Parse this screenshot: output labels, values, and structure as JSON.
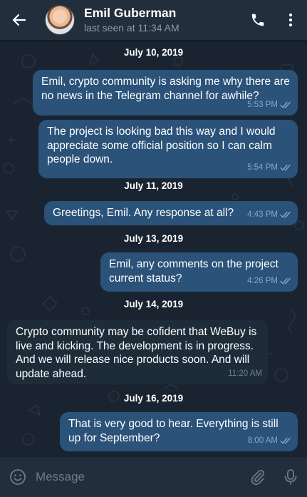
{
  "header": {
    "contact_name": "Emil Guberman",
    "last_seen": "last seen at 11:34 AM"
  },
  "chat": {
    "dates": [
      "July 10, 2019",
      "July 11, 2019",
      "July 13, 2019",
      "July 14, 2019",
      "July 16, 2019"
    ],
    "messages": [
      {
        "direction": "outgoing",
        "text": "Emil, crypto community is asking me why there are no news in the Telegram channel for awhile?",
        "time": "5:53 PM",
        "read": true
      },
      {
        "direction": "outgoing",
        "text": "The project is looking bad this way and I would appreciate some official position so I can calm people down.",
        "time": "5:54 PM",
        "read": true
      },
      {
        "direction": "outgoing",
        "text": "Greetings, Emil. Any response at all?",
        "time": "4:43 PM",
        "read": true
      },
      {
        "direction": "outgoing",
        "text": "Emil, any comments on the project current status?",
        "time": "4:26 PM",
        "read": true
      },
      {
        "direction": "incoming",
        "text": "Crypto community may be cofident that WeBuy is live and kicking. The development is in progress. And we will release nice products soon. And will update ahead.",
        "time": "11:20 AM"
      },
      {
        "direction": "outgoing",
        "text": "That is very good to hear. Everything is still up for September?",
        "time": "8:00 AM",
        "read": true
      }
    ]
  },
  "composer": {
    "placeholder": "Message"
  },
  "colors": {
    "header_bg": "#232e3c",
    "chat_bg": "#1a2430",
    "outgoing_bubble": "#2b5278",
    "incoming_bubble": "#1e2c3a",
    "read_ticks": "#7da8d3"
  },
  "icons": [
    "back-arrow-icon",
    "phone-icon",
    "more-vert-icon",
    "emoji-icon",
    "paperclip-icon",
    "microphone-icon",
    "double-check-icon"
  ]
}
